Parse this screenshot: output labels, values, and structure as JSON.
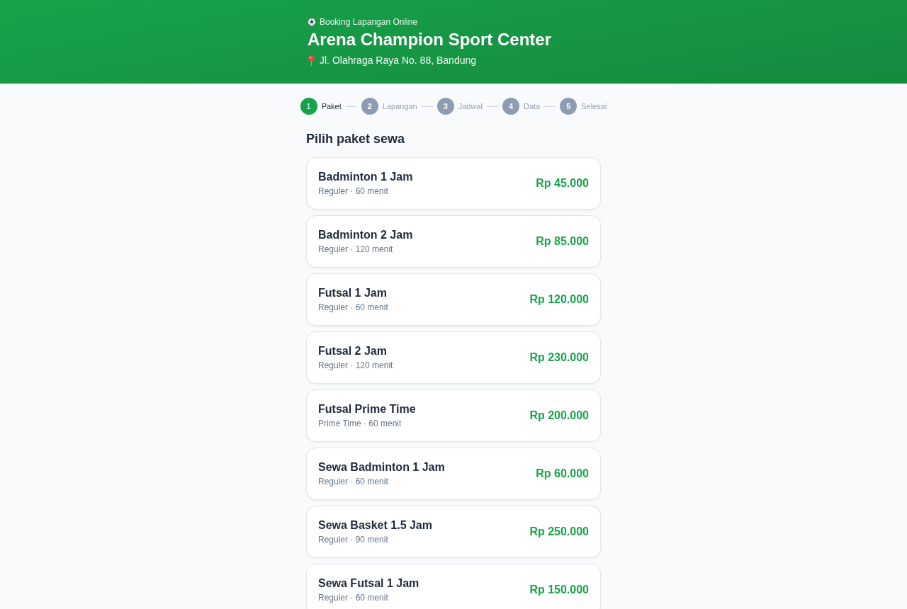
{
  "header": {
    "tagline": "Booking Lapangan Online",
    "title": "Arena Champion Sport Center",
    "address": "Jl. Olahraga Raya No. 88, Bandung"
  },
  "steps": [
    {
      "number": "1",
      "label": "Paket",
      "selected": true
    },
    {
      "number": "2",
      "label": "Lapangan",
      "selected": false
    },
    {
      "number": "3",
      "label": "Jadwal",
      "selected": false
    },
    {
      "number": "4",
      "label": "Data",
      "selected": false
    },
    {
      "number": "5",
      "label": "Selesai",
      "selected": false
    }
  ],
  "section_title": "Pilih paket sewa",
  "packages": [
    {
      "name": "Badminton 1 Jam",
      "detail": "Reguler · 60 menit",
      "price": "Rp 45.000"
    },
    {
      "name": "Badminton 2 Jam",
      "detail": "Reguler · 120 menit",
      "price": "Rp 85.000"
    },
    {
      "name": "Futsal 1 Jam",
      "detail": "Reguler · 60 menit",
      "price": "Rp 120.000"
    },
    {
      "name": "Futsal 2 Jam",
      "detail": "Reguler · 120 menit",
      "price": "Rp 230.000"
    },
    {
      "name": "Futsal Prime Time",
      "detail": "Prime Time · 60 menit",
      "price": "Rp 200.000"
    },
    {
      "name": "Sewa Badminton 1 Jam",
      "detail": "Reguler · 60 menit",
      "price": "Rp 60.000"
    },
    {
      "name": "Sewa Basket 1.5 Jam",
      "detail": "Reguler · 90 menit",
      "price": "Rp 250.000"
    },
    {
      "name": "Sewa Futsal 1 Jam",
      "detail": "Reguler · 60 menit",
      "price": "Rp 150.000"
    }
  ]
}
